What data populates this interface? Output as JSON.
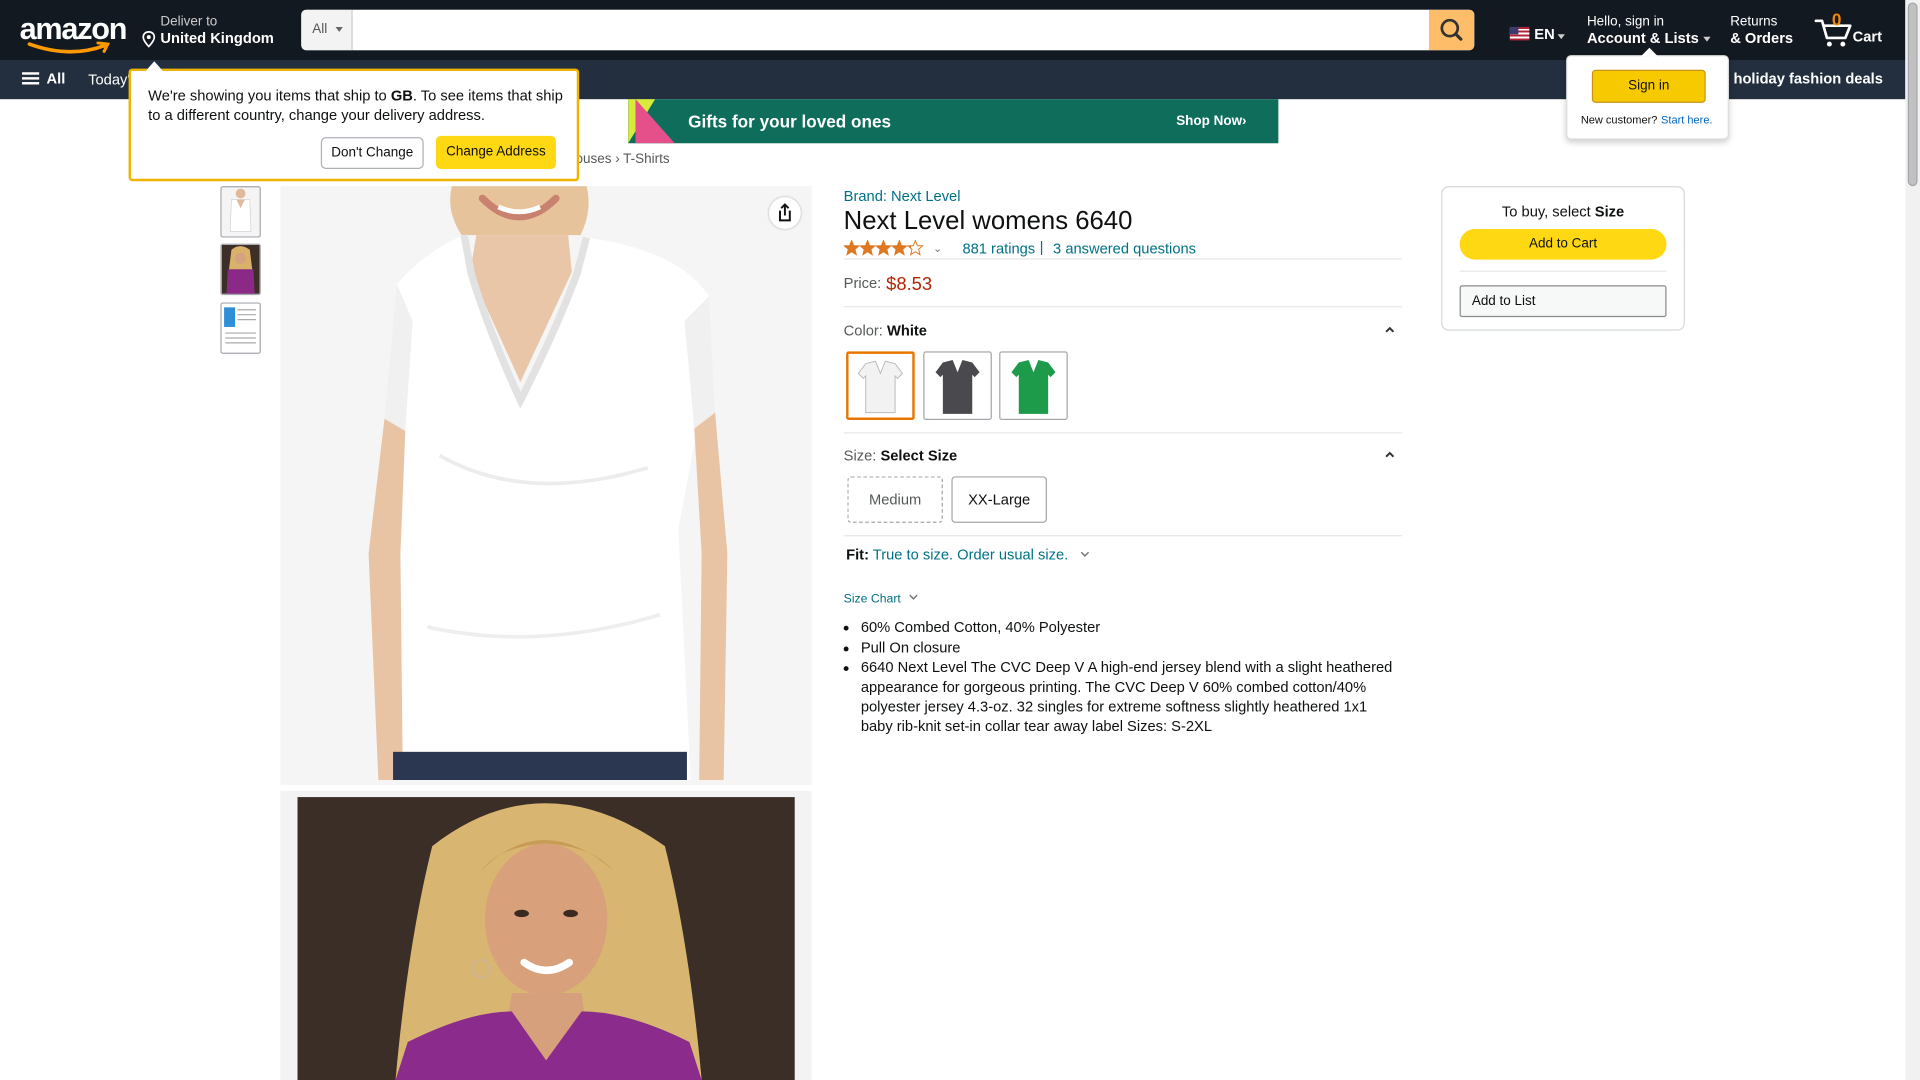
{
  "header": {
    "logo_text": "amazon",
    "deliver_line1": "Deliver to",
    "deliver_line2": "United Kingdom",
    "search_category": "All",
    "search_placeholder": "",
    "lang": "EN",
    "account_line1": "Hello, sign in",
    "account_line2": "Account & Lists",
    "returns_line1": "Returns",
    "returns_line2": "& Orders",
    "cart_count": "0",
    "cart_label": "Cart",
    "accent": "#febd69"
  },
  "subnav": {
    "all_label": "All",
    "today_label": "Today'",
    "deals_label": "o holiday fashion deals"
  },
  "banner": {
    "text": "Gifts for your loved ones",
    "cta": "Shop Now›"
  },
  "breadcrumb": "ouses › T-Shirts",
  "delivery_popover": {
    "msg_pre": "We're showing you items that ship to ",
    "msg_country": "GB",
    "msg_post": ". To see items that ship to a different country, change your delivery address.",
    "dont_change": "Don't Change",
    "change_address": "Change Address"
  },
  "account_flyout": {
    "signin": "Sign in",
    "new_customer": "New customer?",
    "start_here": "Start here."
  },
  "product": {
    "brand": "Brand: Next Level",
    "title": "Next Level womens 6640",
    "rating": 4.2,
    "ratings_count": "881 ratings",
    "separator": "|",
    "answered": "3 answered questions",
    "price_label": "Price:",
    "price": "$8.53",
    "color_label": "Color:",
    "color_value": "White",
    "colors": [
      {
        "name": "White",
        "hex": "#f2f2f2",
        "selected": true
      },
      {
        "name": "Charcoal",
        "hex": "#4a4a4e",
        "selected": false
      },
      {
        "name": "Green",
        "hex": "#1e9b4a",
        "selected": false
      }
    ],
    "size_label": "Size:",
    "size_value": "Select Size",
    "sizes": [
      "Medium",
      "XX-Large"
    ],
    "fit_label": "Fit:",
    "fit_value": "True to size. Order usual size.",
    "size_chart": "Size Chart",
    "bullets": [
      "60% Combed Cotton, 40% Polyester",
      "Pull On closure",
      "6640 Next Level The CVC Deep V A high-end jersey blend with a slight heathered appearance for gorgeous printing. The CVC Deep V 60% combed cotton/40% polyester jersey 4.3-oz. 32 singles for extreme softness slightly heathered 1x1 baby rib-knit set-in collar tear away label Sizes: S-2XL"
    ]
  },
  "buybox": {
    "head_pre": "To buy, select ",
    "head_bold": "Size",
    "add_to_cart": "Add to Cart",
    "add_to_list": "Add to List"
  }
}
